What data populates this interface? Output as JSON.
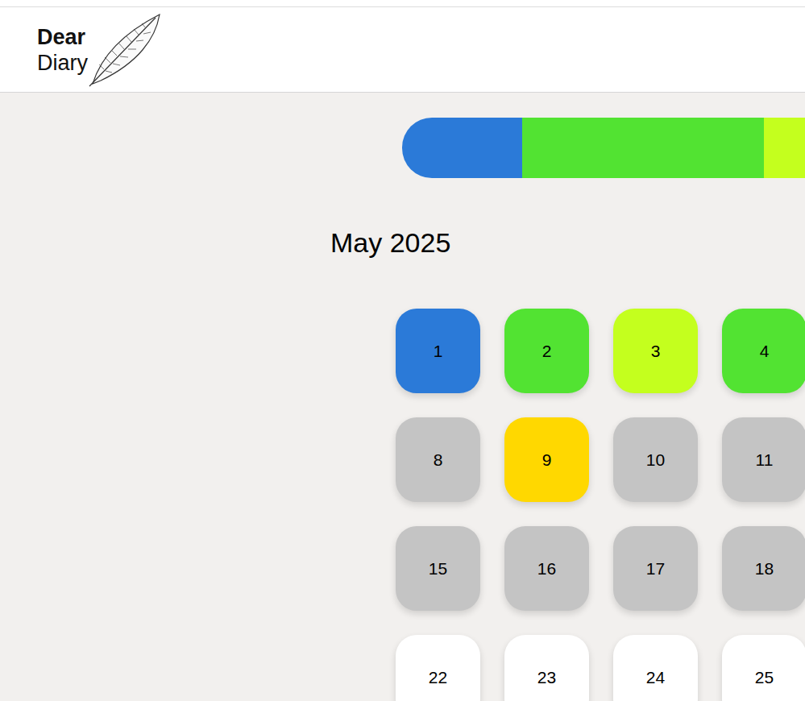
{
  "logo": {
    "line1": "Dear",
    "line2": "Diary"
  },
  "mood_bar": {
    "segments": [
      {
        "color": "#2b7ad8",
        "level": 0.1656
      },
      {
        "color": "#52e332",
        "level": 0.3333
      },
      {
        "color": "#c4ff1e",
        "level": 0.5011
      }
    ]
  },
  "calendar": {
    "title": "May 2025",
    "rows": [
      [
        {
          "day": "1",
          "color": "#2b7ad8"
        },
        {
          "day": "2",
          "color": "#52e332"
        },
        {
          "day": "3",
          "color": "#c4ff1e"
        },
        {
          "day": "4",
          "color": "#52e332"
        }
      ],
      [
        {
          "day": "8",
          "color": "#c4c4c4"
        },
        {
          "day": "9",
          "color": "#ffd800"
        },
        {
          "day": "10",
          "color": "#c4c4c4"
        },
        {
          "day": "11",
          "color": "#c4c4c4"
        }
      ],
      [
        {
          "day": "15",
          "color": "#c4c4c4"
        },
        {
          "day": "16",
          "color": "#c4c4c4"
        },
        {
          "day": "17",
          "color": "#c4c4c4"
        },
        {
          "day": "18",
          "color": "#c4c4c4"
        }
      ],
      [
        {
          "day": "22",
          "color": "#ffffff"
        },
        {
          "day": "23",
          "color": "#ffffff"
        },
        {
          "day": "24",
          "color": "#ffffff"
        },
        {
          "day": "25",
          "color": "#ffffff"
        }
      ]
    ]
  }
}
